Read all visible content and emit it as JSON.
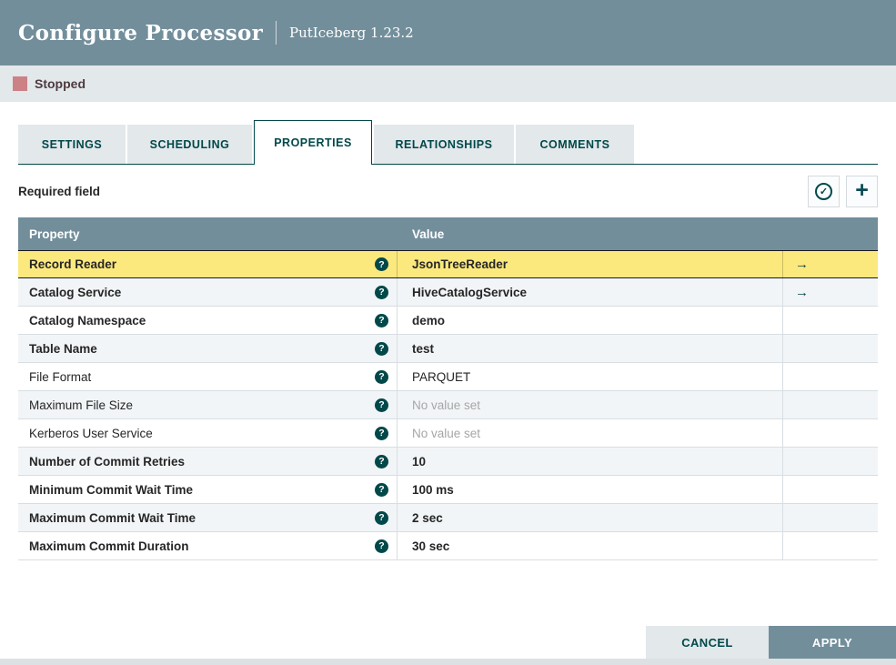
{
  "dialog": {
    "title": "Configure Processor",
    "subtitle": "PutIceberg 1.23.2",
    "status_label": "Stopped"
  },
  "tabs": [
    {
      "label": "SETTINGS",
      "active": false
    },
    {
      "label": "SCHEDULING",
      "active": false
    },
    {
      "label": "PROPERTIES",
      "active": true
    },
    {
      "label": "RELATIONSHIPS",
      "active": false
    },
    {
      "label": "COMMENTS",
      "active": false
    }
  ],
  "properties_panel": {
    "hint": "Required field",
    "table": {
      "property_header": "Property",
      "value_header": "Value",
      "rows": [
        {
          "property": "Record Reader",
          "value": "JsonTreeReader",
          "required": true,
          "selected": true,
          "has_link": true,
          "value_set": true
        },
        {
          "property": "Catalog Service",
          "value": "HiveCatalogService",
          "required": true,
          "selected": false,
          "has_link": true,
          "value_set": true
        },
        {
          "property": "Catalog Namespace",
          "value": "demo",
          "required": true,
          "selected": false,
          "has_link": false,
          "value_set": true
        },
        {
          "property": "Table Name",
          "value": "test",
          "required": true,
          "selected": false,
          "has_link": false,
          "value_set": true
        },
        {
          "property": "File Format",
          "value": "PARQUET",
          "required": false,
          "selected": false,
          "has_link": false,
          "value_set": true
        },
        {
          "property": "Maximum File Size",
          "value": "No value set",
          "required": false,
          "selected": false,
          "has_link": false,
          "value_set": false
        },
        {
          "property": "Kerberos User Service",
          "value": "No value set",
          "required": false,
          "selected": false,
          "has_link": false,
          "value_set": false
        },
        {
          "property": "Number of Commit Retries",
          "value": "10",
          "required": true,
          "selected": false,
          "has_link": false,
          "value_set": true
        },
        {
          "property": "Minimum Commit Wait Time",
          "value": "100 ms",
          "required": true,
          "selected": false,
          "has_link": false,
          "value_set": true
        },
        {
          "property": "Maximum Commit Wait Time",
          "value": "2 sec",
          "required": true,
          "selected": false,
          "has_link": false,
          "value_set": true
        },
        {
          "property": "Maximum Commit Duration",
          "value": "30 sec",
          "required": true,
          "selected": false,
          "has_link": false,
          "value_set": true
        }
      ]
    }
  },
  "footer": {
    "cancel_label": "CANCEL",
    "apply_label": "APPLY"
  },
  "icons": {
    "question_glyph": "?",
    "plus_glyph": "+",
    "check_glyph": "✓",
    "goto_arrow_glyph": "→"
  },
  "colors": {
    "header_bg": "#728e9b",
    "accent_teal": "#004849",
    "status_strip_bg": "#e3e8eb",
    "stopped_red": "#cc8186",
    "selected_row_bg": "#fce97e",
    "alt_row_bg": "#f2f5f7",
    "unset_text": "#a6a6a6"
  }
}
